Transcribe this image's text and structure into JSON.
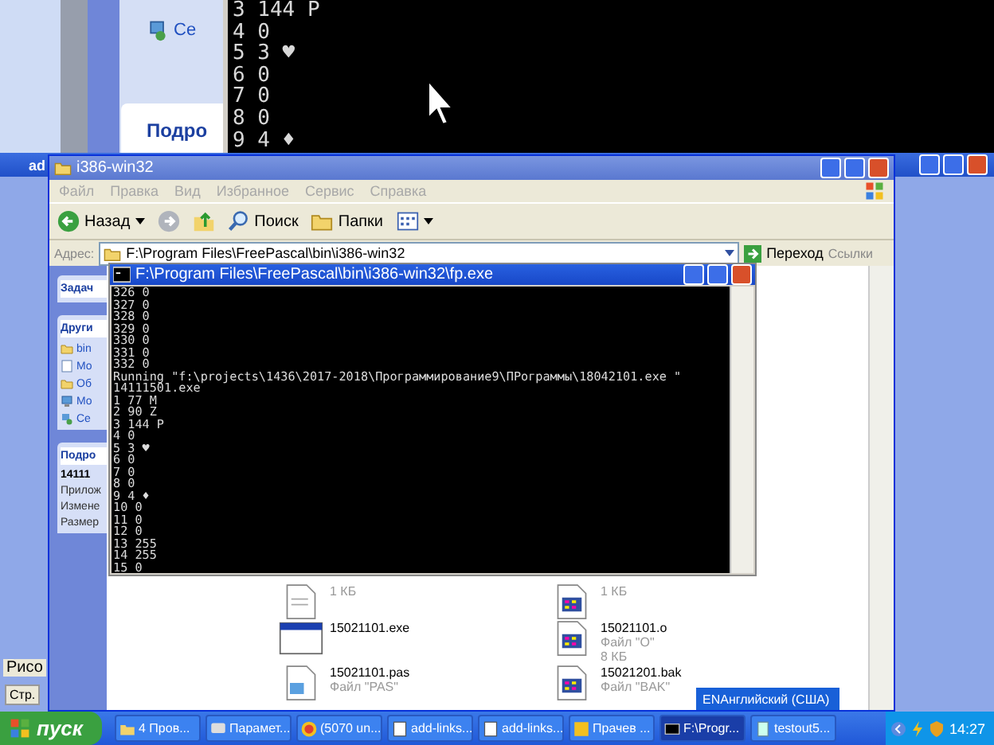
{
  "top_console": {
    "lines": [
      "3 144 P",
      "4 0",
      "5 3 ♥",
      "6 0",
      "7 0",
      "8 0",
      "9 4 ♦"
    ]
  },
  "task_pane_fragment": {
    "link": "Се",
    "heading": "Подро"
  },
  "back_window": {
    "title": "ad",
    "left_texts": [
      "Рисо",
      "Стр."
    ]
  },
  "explorer": {
    "title": "i386-win32",
    "menu": [
      "Файл",
      "Правка",
      "Вид",
      "Избранное",
      "Сервис",
      "Справка"
    ],
    "toolbar": [
      {
        "kind": "back",
        "label": "Назад"
      },
      {
        "kind": "forward"
      },
      {
        "kind": "up"
      },
      {
        "kind": "search",
        "label": "Поиск"
      },
      {
        "kind": "folders",
        "label": "Папки"
      },
      {
        "kind": "views"
      }
    ],
    "address": {
      "label": "Адрес:",
      "value": "F:\\Program Files\\FreePascal\\bin\\i386-win32",
      "go": "Переход",
      "links": "Ссылки"
    },
    "side_panel": [
      {
        "title": "Задач"
      },
      {
        "title": "Други",
        "items": [
          {
            "kind": "folder",
            "label": "bin"
          },
          {
            "kind": "document",
            "label": "Мо"
          },
          {
            "kind": "folder",
            "label": "Об"
          },
          {
            "kind": "computer",
            "label": "Мо"
          },
          {
            "kind": "network",
            "label": "Се"
          }
        ]
      },
      {
        "title": "Подро",
        "items": [
          {
            "kind": "name",
            "label": "14111"
          },
          {
            "kind": "property",
            "label": "Прилож"
          },
          {
            "kind": "property",
            "label": "Измене"
          },
          {
            "kind": "property",
            "label": "Размер"
          }
        ]
      }
    ],
    "files": [
      {
        "kind": "text",
        "size": "1 КБ"
      },
      {
        "kind": "grid",
        "size": "1 КБ"
      },
      {
        "kind": "exe",
        "name": "15021101.exe"
      },
      {
        "kind": "grid",
        "name": "15021101.o",
        "type": "Файл \"O\"",
        "size": "8 КБ"
      },
      {
        "kind": "pas",
        "name": "15021101.pas",
        "type": "Файл \"PAS\""
      },
      {
        "kind": "grid",
        "name": "15021201.bak",
        "type": "Файл \"BAK\""
      }
    ]
  },
  "console": {
    "title": "F:\\Program Files\\FreePascal\\bin\\i386-win32\\fp.exe",
    "lines": [
      "326 0",
      "327 0",
      "328 0",
      "329 0",
      "330 0",
      "331 0",
      "332 0",
      "Running \"f:\\projects\\1436\\2017-2018\\Программирование9\\ПРограммы\\18042101.exe \"",
      "14111501.exe",
      "1 77 M",
      "2 90 Z",
      "3 144 P",
      "4 0",
      "5 3 ♥",
      "6 0",
      "7 0",
      "8 0",
      "9 4 ♦",
      "10 0",
      "11 0",
      "12 0",
      "13 255",
      "14 255",
      "15 0"
    ]
  },
  "language_bar": "ENАнглийский (США)",
  "taskbar": {
    "start": "пуск",
    "tasks": [
      {
        "kind": "folder",
        "label": "4 Пров...",
        "selected": false
      },
      {
        "kind": "chat",
        "label": "Парамет...",
        "selected": false
      },
      {
        "kind": "browser",
        "label": "(5070 un...",
        "selected": false
      },
      {
        "kind": "document",
        "label": "add-links...",
        "selected": false
      },
      {
        "kind": "document",
        "label": "add-links...",
        "selected": false
      },
      {
        "kind": "k",
        "label": "Прачев ...",
        "selected": false
      },
      {
        "kind": "console",
        "label": "F:\\Progr...",
        "selected": true
      },
      {
        "kind": "file",
        "label": "testout5...",
        "selected": false
      }
    ],
    "clock": "14:27"
  }
}
